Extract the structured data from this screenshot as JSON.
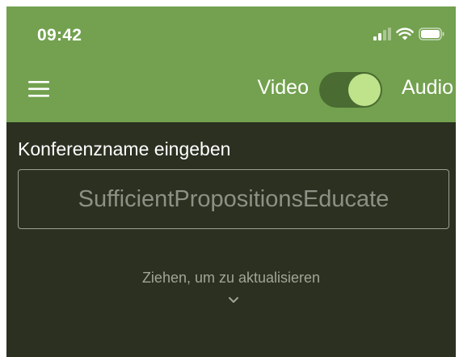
{
  "status_bar": {
    "time": "09:42",
    "icons": [
      "signal-icon",
      "wifi-icon",
      "battery-icon"
    ]
  },
  "header": {
    "menu_icon": "hamburger-menu-icon",
    "mode_toggle": {
      "left_label": "Video",
      "right_label": "Audio",
      "selected": "Audio"
    }
  },
  "main": {
    "conference_label": "Konferenzname eingeben",
    "conference_input": {
      "value": "",
      "placeholder": "SufficientPropositionsEducate"
    },
    "pull_to_refresh": {
      "text": "Ziehen, um zu aktualisieren",
      "icon": "chevron-down-icon"
    }
  },
  "colors": {
    "header_green": "#73a14f",
    "background_dark": "#2b3021",
    "toggle_knob": "#bfe38a",
    "toggle_track": "#4a6b31"
  }
}
